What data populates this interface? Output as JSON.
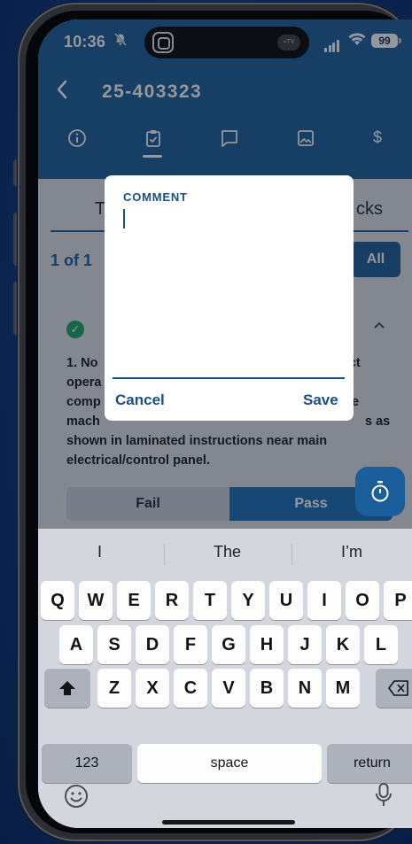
{
  "status_bar": {
    "time": "10:36",
    "battery": "99",
    "tv_badge": "«TV"
  },
  "header": {
    "back_icon": "chevron-left-icon",
    "title": "25-403323",
    "tabs": [
      {
        "name": "info-tab",
        "icon": "info-icon"
      },
      {
        "name": "checklist-tab",
        "icon": "clipboard-check-icon",
        "active": true
      },
      {
        "name": "comments-tab",
        "icon": "comment-icon"
      },
      {
        "name": "photos-tab",
        "icon": "image-icon"
      },
      {
        "name": "cost-tab",
        "icon": "dollar-icon",
        "label": "$"
      }
    ]
  },
  "content": {
    "segment_left": "T",
    "segment_right": "cks",
    "counter": "1 of 1",
    "all_button": "All",
    "item_text_lines": [
      "1. No",
      "opera",
      "comp",
      "mach",
      "shown in laminated instructions near main",
      "electrical/control panel."
    ],
    "item_text_right": [
      "uct",
      "e",
      "s as"
    ],
    "fail_label": "Fail",
    "pass_label": "Pass"
  },
  "dialog": {
    "label": "COMMENT",
    "value": "",
    "cancel_label": "Cancel",
    "save_label": "Save"
  },
  "keyboard": {
    "suggestions": [
      "I",
      "The",
      "I’m"
    ],
    "row1": [
      "Q",
      "W",
      "E",
      "R",
      "T",
      "Y",
      "U",
      "I",
      "O",
      "P"
    ],
    "row2": [
      "A",
      "S",
      "D",
      "F",
      "G",
      "H",
      "J",
      "K",
      "L"
    ],
    "row3": [
      "Z",
      "X",
      "C",
      "V",
      "B",
      "N",
      "M"
    ],
    "numbers_key": "123",
    "space_key": "space",
    "return_key": "return"
  },
  "colors": {
    "brand": "#1a5e9b",
    "pass": "#1a6eb8",
    "check": "#1ea56a"
  }
}
